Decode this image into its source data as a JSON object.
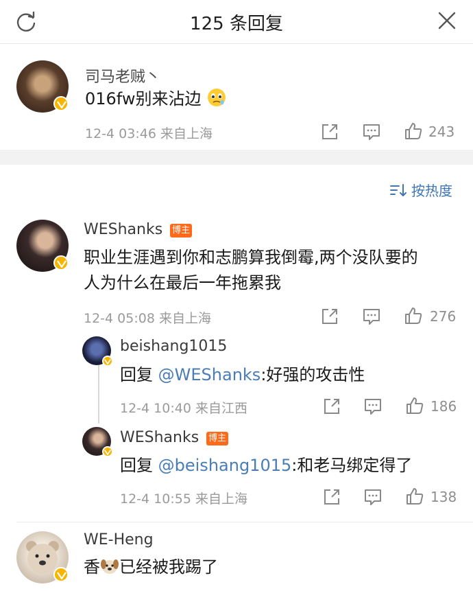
{
  "header": {
    "title": "125 条回复"
  },
  "main_comment": {
    "username": "司马老贼丶",
    "text": "016fw别来沾边",
    "emoji": "emoji-pleading-face-icon",
    "meta": "12-4 03:46  来自上海",
    "likes": "243"
  },
  "sort": {
    "label": "按热度"
  },
  "replies": [
    {
      "username": "WEShanks",
      "tag": "博主",
      "text_line1": "职业生涯遇到你和志鹏算我倒霉,两个没队要的",
      "text_line2": "人为什么在最后一年拖累我",
      "meta": "12-4 05:08  来自上海",
      "likes": "276",
      "sub_replies": [
        {
          "username": "beishang1015",
          "reply_prefix": "回复 ",
          "mention": "@WEShanks",
          "text": ":好强的攻击性",
          "meta": "12-4 10:40  来自江西",
          "likes": "186"
        },
        {
          "username": "WEShanks",
          "tag": "博主",
          "reply_prefix": "回复 ",
          "mention": "@beishang1015",
          "text": ":和老马绑定得了",
          "meta": "12-4 10:55  来自上海",
          "likes": "138"
        }
      ]
    },
    {
      "username": "WE-Heng",
      "text_before": "香",
      "emoji": "emoji-dog-face-icon",
      "text_after": "已经被我踢了"
    }
  ],
  "colors": {
    "accent": "#3e76b5",
    "vip": "#f7b500",
    "blogger_tag": "#ff6a1a"
  }
}
